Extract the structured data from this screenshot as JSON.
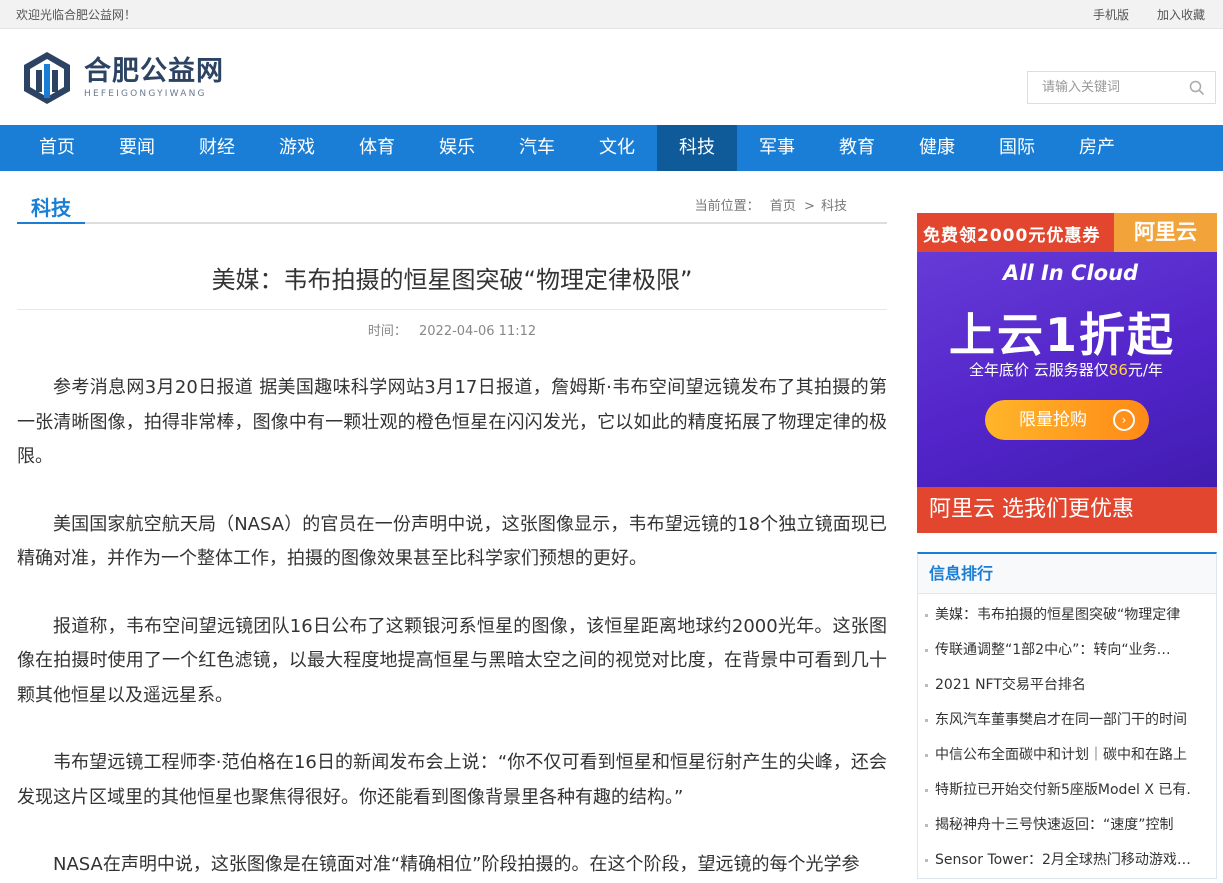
{
  "topbar": {
    "welcome": "欢迎光临合肥公益网！",
    "mobile": "手机版",
    "favorite": "加入收藏"
  },
  "logo": {
    "cn": "合肥公益网",
    "en": "HEFEIGONGYIWANG"
  },
  "search": {
    "placeholder": "请输入关键词"
  },
  "nav": [
    "首页",
    "要闻",
    "财经",
    "游戏",
    "体育",
    "娱乐",
    "汽车",
    "文化",
    "科技",
    "军事",
    "教育",
    "健康",
    "国际",
    "房产"
  ],
  "nav_active": "科技",
  "category": {
    "title": "科技",
    "crumb_label": "当前位置：",
    "crumb_home": "首页",
    "crumb_sep": ">",
    "crumb_current": "科技"
  },
  "article": {
    "title": "美媒：韦布拍摄的恒星图突破“物理定律极限”",
    "time_label": "时间：",
    "time": "2022-04-06 11:12",
    "paragraphs": [
      "参考消息网3月20日报道 据美国趣味科学网站3月17日报道，詹姆斯·韦布空间望远镜发布了其拍摄的第一张清晰图像，拍得非常棒，图像中有一颗壮观的橙色恒星在闪闪发光，它以如此的精度拓展了物理定律的极限。",
      "美国国家航空航天局（NASA）的官员在一份声明中说，这张图像显示，韦布望远镜的18个独立镜面现已精确对准，并作为一个整体工作，拍摄的图像效果甚至比科学家们预想的更好。",
      "报道称，韦布空间望远镜团队16日公布了这颗银河系恒星的图像，该恒星距离地球约2000光年。这张图像在拍摄时使用了一个红色滤镜，以最大程度地提高恒星与黑暗太空之间的视觉对比度，在背景中可看到几十颗其他恒星以及遥远星系。",
      "韦布望远镜工程师李·范伯格在16日的新闻发布会上说：“你不仅可看到恒星和恒星衍射产生的尖峰，还会发现这片区域里的其他恒星也聚焦得很好。你还能看到图像背景里各种有趣的结构。”",
      "NASA在声明中说，这张图像是在镜面对准“精确相位”阶段拍摄的。在这个阶段，望远镜的每个光学参"
    ]
  },
  "ad": {
    "top_left": "免费领2000元优惠券",
    "top_right": "阿里云",
    "cloud": "All In Cloud",
    "headline": "上云1折起",
    "sub_prefix": "全年底价  云服务器仅",
    "sub_price": "86",
    "sub_suffix": "元/年",
    "button": "限量抢购",
    "bottom": "阿里云 选我们更优惠"
  },
  "rank": {
    "title": "信息排行",
    "items": [
      "美媒：韦布拍摄的恒星图突破“物理定律",
      "传联通调整“1部2中心”：转向“业务…",
      "2021 NFT交易平台排名",
      "东风汽车董事樊启才在同一部门干的时间",
      "中信公布全面碳中和计划｜碳中和在路上",
      "特斯拉已开始交付新5座版Model X 已有.",
      "揭秘神舟十三号快速返回：“速度”控制",
      "Sensor Tower：2月全球热门移动游戏…"
    ]
  }
}
